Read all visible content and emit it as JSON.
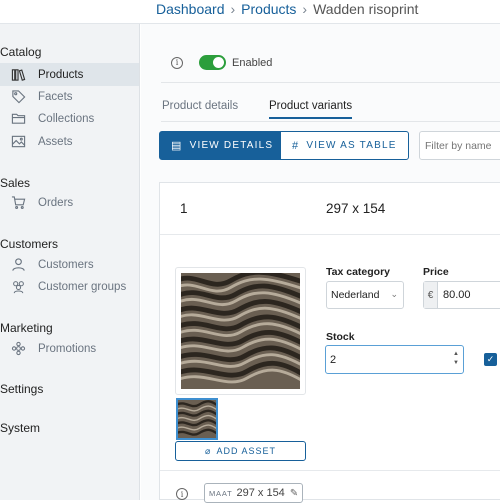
{
  "breadcrumb": {
    "items": [
      "Dashboard",
      "Products"
    ],
    "current": "Wadden risoprint",
    "separator": "›"
  },
  "sidebar": {
    "sections": [
      {
        "title": "Catalog",
        "items": [
          {
            "label": "Products",
            "icon": "books-icon",
            "active": true
          },
          {
            "label": "Facets",
            "icon": "tag-icon"
          },
          {
            "label": "Collections",
            "icon": "folder-icon"
          },
          {
            "label": "Assets",
            "icon": "image-icon"
          }
        ]
      },
      {
        "title": "Sales",
        "items": [
          {
            "label": "Orders",
            "icon": "cart-icon"
          }
        ]
      },
      {
        "title": "Customers",
        "items": [
          {
            "label": "Customers",
            "icon": "user-icon"
          },
          {
            "label": "Customer groups",
            "icon": "users-icon"
          }
        ]
      },
      {
        "title": "Marketing",
        "items": [
          {
            "label": "Promotions",
            "icon": "gear-flower-icon"
          }
        ]
      },
      {
        "title": "Settings",
        "items": []
      },
      {
        "title": "System",
        "items": []
      }
    ]
  },
  "main": {
    "enabled_label": "Enabled",
    "enabled": true,
    "tabs": [
      {
        "label": "Product details"
      },
      {
        "label": "Product variants",
        "active": true
      }
    ],
    "view_details_label": "VIEW DETAILS",
    "view_table_label": "VIEW AS TABLE",
    "filter_placeholder": "Filter by name",
    "variant": {
      "number": "1",
      "name": "297 x 154",
      "add_asset_label": "ADD ASSET",
      "tax_category_label": "Tax category",
      "tax_category_value": "Nederland",
      "price_label": "Price",
      "currency_symbol": "€",
      "price_value": "80.00",
      "stock_label": "Stock",
      "stock_value": "2",
      "track_inventory": true,
      "facet": {
        "key": "MAAT",
        "value": "297 x 154"
      }
    }
  },
  "colors": {
    "accent": "#17609a",
    "enabled_toggle": "#2c9e3c",
    "sidebar_bg": "#f1f3f5",
    "active_item_bg": "#dfe5ea"
  }
}
